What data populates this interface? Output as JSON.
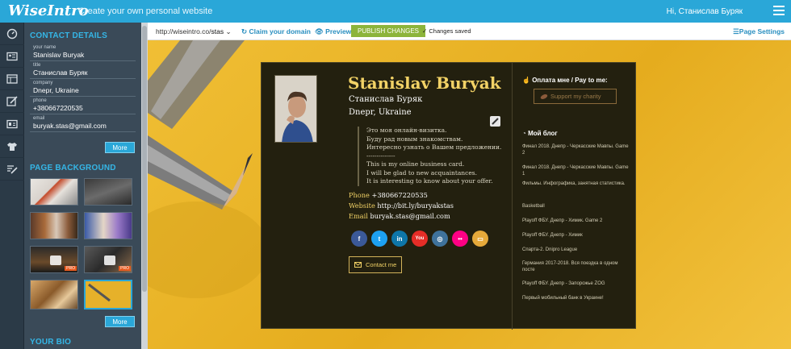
{
  "topbar": {
    "logo": "WiseIntro",
    "tagline": "Create your own personal website",
    "user": "Hi, Станислав Буряк"
  },
  "sidebar": {
    "icons": [
      "dashboard-icon",
      "card-icon",
      "layout-icon",
      "design-icon",
      "profile-icon",
      "tshirt-icon",
      "edit-list-icon"
    ]
  },
  "contact": {
    "heading": "CONTACT DETAILS",
    "fields": [
      {
        "label": "your name",
        "value": "Stanislav Buryak"
      },
      {
        "label": "title",
        "value": "Станислав Буряк"
      },
      {
        "label": "company",
        "value": "Dnepr, Ukraine"
      },
      {
        "label": "phone",
        "value": "+380667220535"
      },
      {
        "label": "email",
        "value": "buryak.stas@gmail.com"
      }
    ],
    "more": "More"
  },
  "background": {
    "heading": "PAGE BACKGROUND",
    "more": "More",
    "pro_label": "PRO"
  },
  "bio": {
    "heading": "YOUR BIO"
  },
  "urlbar": {
    "prefix": "http://wiseintro.co/",
    "slug": "stas",
    "claim": "Claim your domain",
    "preview": "Preview",
    "publish": "PUBLISH CHANGES",
    "saved": "Changes saved",
    "page_settings": "Page Settings"
  },
  "card": {
    "name": "Stanislav Buryak",
    "title": "Станислав Буряк",
    "company": "Dnepr, Ukraine",
    "bio": "Это моя онлайн-визитка.\nБуду рад новым знакомствам.\nИнтересно узнать о Вашем предложении.\n--------------\nThis is my online business card.\nI will be glad to new acquaintances.\nIt is interesting to know about your offer.",
    "phone_label": "Phone",
    "phone": "+380667220535",
    "website_label": "Website",
    "website": "http://bit.ly/buryakstas",
    "email_label": "Email",
    "email": "buryak.stas@gmail.com",
    "socials": [
      {
        "name": "facebook-icon",
        "glyph": "f",
        "color": "#3b5998"
      },
      {
        "name": "twitter-icon",
        "glyph": "t",
        "color": "#1da1f2"
      },
      {
        "name": "linkedin-icon",
        "glyph": "in",
        "color": "#0e76a8"
      },
      {
        "name": "youtube-icon",
        "glyph": "You",
        "color": "#e52d27"
      },
      {
        "name": "instagram-icon",
        "glyph": "◎",
        "color": "#3f729b"
      },
      {
        "name": "flickr-icon",
        "glyph": "••",
        "color": "#ff0084"
      },
      {
        "name": "blogger-icon",
        "glyph": "▭",
        "color": "#e6a93a"
      }
    ],
    "contact_button": "Contact me"
  },
  "side": {
    "pay_title": "Оплата мне / Pay to me:",
    "charity": "Support my charity",
    "blog_title": "Мой блог",
    "blog_items": [
      "Финал 2018. Днепр - Черкасские Мавпы. Game 2",
      "Финал 2018. Днепр - Черкасские Мавпы. Game 1",
      "Фильмы. Инфографика, занятная статистика.",
      "Basketball",
      "Playoff ФБУ. Днепр - Химик. Game 2",
      "Playoff ФБУ. Днепр - Химик",
      "Спарта-2. Dnipro League",
      "Германия 2017-2018. Вся поездка в одном посте",
      "Playoff ФБУ. Днепр - Запорожье ZOG",
      "Первый мобильный банк в Украине!"
    ]
  }
}
